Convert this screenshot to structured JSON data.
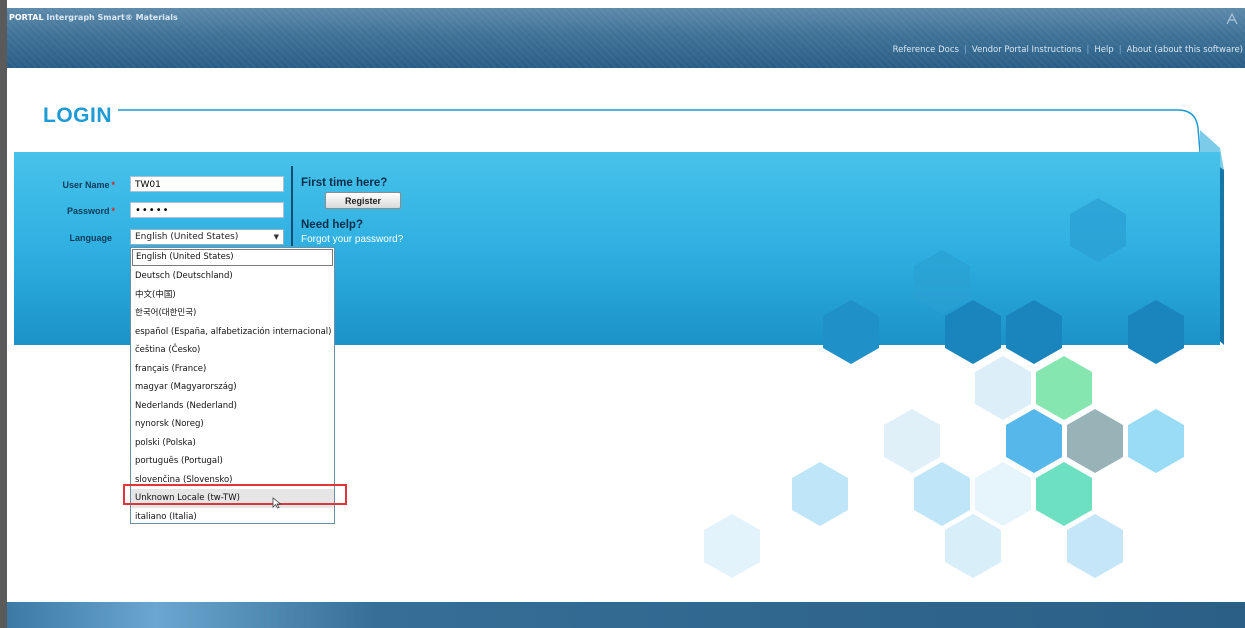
{
  "header": {
    "brand_portal": "PORTAL",
    "brand_product": "Intergraph Smart® Materials",
    "links": [
      "Reference Docs",
      "Vendor Portal Instructions",
      "Help",
      "About (about this software)"
    ]
  },
  "login": {
    "title": "LOGIN",
    "username_label": "User Name",
    "username_value": "TW01",
    "password_label": "Password",
    "password_value": "•••••",
    "required_mark": "*",
    "language_label": "Language",
    "language_selected": "English (United States)"
  },
  "side": {
    "first_time": "First time here?",
    "register": "Register",
    "need_help": "Need help?",
    "forgot": "Forgot your password?"
  },
  "language_options": [
    "English (United States)",
    "Deutsch (Deutschland)",
    "中文(中国)",
    "한국어(대한민국)",
    "español (España, alfabetización internacional)",
    "čeština (Česko)",
    "français (France)",
    "magyar (Magyarország)",
    "Nederlands (Nederland)",
    "nynorsk (Noreg)",
    "polski (Polska)",
    "português (Portugal)",
    "slovenčina (Slovensko)",
    "Unknown Locale (tw-TW)",
    "italiano (Italia)"
  ],
  "highlighted_option": "Unknown Locale (tw-TW)",
  "colors": {
    "accent": "#1e9ad6",
    "band": "#2fb0e1",
    "highlight_box": "#e0353f"
  }
}
